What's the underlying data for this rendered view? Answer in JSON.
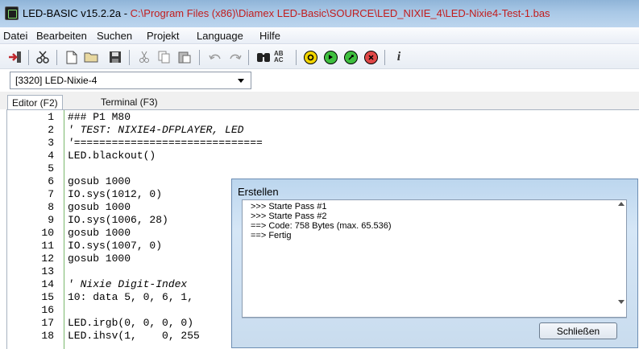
{
  "window": {
    "title_app": "LED-BASIC v15.2.2a - ",
    "title_path": "C:\\Program Files (x86)\\Diamex LED-Basic\\SOURCE\\LED_NIXIE_4\\LED-Nixie4-Test-1.bas"
  },
  "menu": {
    "items": [
      "Datei",
      "Bearbeiten",
      "Suchen",
      "Projekt",
      "Language",
      "Hilfe"
    ]
  },
  "toolbar": {
    "icons": [
      "import-icon",
      "cut-tool-icon",
      "new-file-icon",
      "open-folder-icon",
      "save-icon",
      "cut-icon",
      "copy-icon",
      "paste-icon",
      "undo-icon",
      "redo-icon",
      "find-icon",
      "replace-icon",
      "compile-icon",
      "run-icon",
      "debug-icon",
      "stop-icon",
      "info-icon"
    ],
    "replace_text": "AB AC",
    "info_text": "i"
  },
  "project_select": {
    "value": "[3320] LED-Nixie-4"
  },
  "tabs": [
    {
      "label": "Editor (F2)",
      "active": true
    },
    {
      "label": "Terminal (F3)",
      "active": false
    }
  ],
  "editor": {
    "lines": [
      {
        "n": "1",
        "text": "### P1 M80"
      },
      {
        "n": "2",
        "text": "' TEST: NIXIE4-DFPLAYER, LED"
      },
      {
        "n": "3",
        "text": "'=============================="
      },
      {
        "n": "4",
        "text": "LED.blackout()"
      },
      {
        "n": "5",
        "text": ""
      },
      {
        "n": "6",
        "text": "gosub 1000"
      },
      {
        "n": "7",
        "text": "IO.sys(1012, 0)"
      },
      {
        "n": "8",
        "text": "gosub 1000"
      },
      {
        "n": "9",
        "text": "IO.sys(1006, 28)"
      },
      {
        "n": "10",
        "text": "gosub 1000"
      },
      {
        "n": "11",
        "text": "IO.sys(1007, 0)"
      },
      {
        "n": "12",
        "text": "gosub 1000"
      },
      {
        "n": "13",
        "text": ""
      },
      {
        "n": "14",
        "text": "' Nixie Digit-Index"
      },
      {
        "n": "15",
        "text": "10: data 5, 0, 6, 1,"
      },
      {
        "n": "16",
        "text": ""
      },
      {
        "n": "17",
        "text": "LED.irgb(0, 0, 0, 0)"
      },
      {
        "n": "18",
        "text": "LED.ihsv(1,    0, 255"
      }
    ]
  },
  "dialog": {
    "title": "Erstellen",
    "log": [
      ">>> Starte Pass #1",
      ">>> Starte Pass #2",
      "==> Code: 758 Bytes (max. 65.536)",
      "==> Fertig"
    ],
    "close_label": "Schließen"
  }
}
